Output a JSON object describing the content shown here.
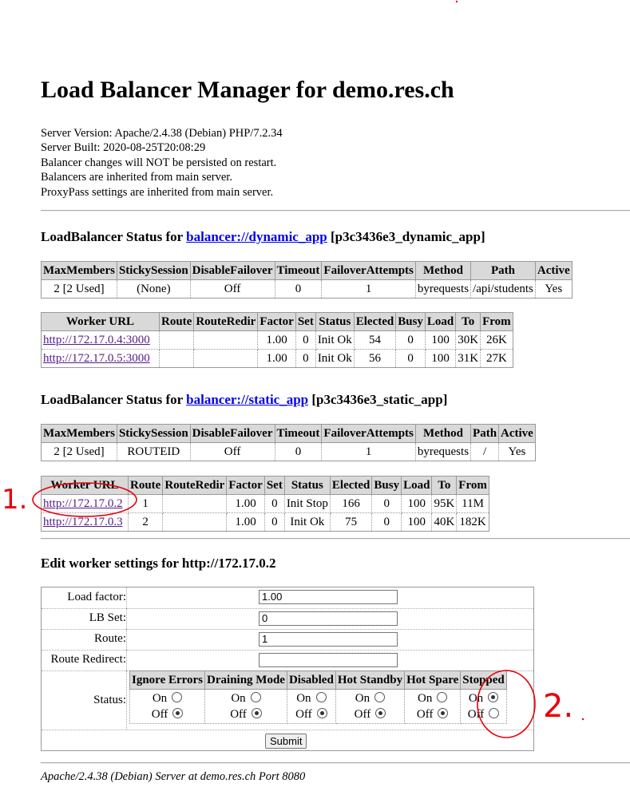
{
  "title": "Load Balancer Manager for demo.res.ch",
  "server_info": [
    "Server Version: Apache/2.4.38 (Debian) PHP/7.2.34",
    "Server Built: 2020-08-25T20:08:29",
    "Balancer changes will NOT be persisted on restart.",
    "Balancers are inherited from main server.",
    "ProxyPass settings are inherited from main server."
  ],
  "balancer1": {
    "heading_prefix": "LoadBalancer Status for ",
    "link": "balancer://dynamic_app",
    "suffix": " [p3c3436e3_dynamic_app]",
    "status_headers": [
      "MaxMembers",
      "StickySession",
      "DisableFailover",
      "Timeout",
      "FailoverAttempts",
      "Method",
      "Path",
      "Active"
    ],
    "status_row": [
      "2 [2 Used]",
      "(None)",
      "Off",
      "0",
      "1",
      "byrequests",
      "/api/students",
      "Yes"
    ],
    "worker_headers": [
      "Worker URL",
      "Route",
      "RouteRedir",
      "Factor",
      "Set",
      "Status",
      "Elected",
      "Busy",
      "Load",
      "To",
      "From"
    ],
    "workers": [
      [
        "http://172.17.0.4:3000",
        "",
        "",
        "1.00",
        "0",
        "Init Ok",
        "54",
        "0",
        "100",
        "30K",
        "26K"
      ],
      [
        "http://172.17.0.5:3000",
        "",
        "",
        "1.00",
        "0",
        "Init Ok",
        "56",
        "0",
        "100",
        "31K",
        "27K"
      ]
    ]
  },
  "balancer2": {
    "heading_prefix": "LoadBalancer Status for ",
    "link": "balancer://static_app",
    "suffix": " [p3c3436e3_static_app]",
    "status_headers": [
      "MaxMembers",
      "StickySession",
      "DisableFailover",
      "Timeout",
      "FailoverAttempts",
      "Method",
      "Path",
      "Active"
    ],
    "status_row": [
      "2 [2 Used]",
      "ROUTEID",
      "Off",
      "0",
      "1",
      "byrequests",
      "/",
      "Yes"
    ],
    "worker_headers": [
      "Worker URL",
      "Route",
      "RouteRedir",
      "Factor",
      "Set",
      "Status",
      "Elected",
      "Busy",
      "Load",
      "To",
      "From"
    ],
    "workers": [
      [
        "http://172.17.0.2",
        "1",
        "",
        "1.00",
        "0",
        "Init Stop",
        "166",
        "0",
        "100",
        "95K",
        "11M"
      ],
      [
        "http://172.17.0.3",
        "2",
        "",
        "1.00",
        "0",
        "Init Ok",
        "75",
        "0",
        "100",
        "40K",
        "182K"
      ]
    ]
  },
  "edit": {
    "heading": "Edit worker settings for http://172.17.0.2",
    "load_factor_label": "Load factor:",
    "load_factor_value": "1.00",
    "lb_set_label": "LB Set:",
    "lb_set_value": "0",
    "route_label": "Route:",
    "route_value": "1",
    "route_redirect_label": "Route Redirect:",
    "route_redirect_value": "",
    "status_label": "Status:",
    "status_headers": [
      "Ignore Errors",
      "Draining Mode",
      "Disabled",
      "Hot Standby",
      "Hot Spare",
      "Stopped"
    ],
    "on_label": "On",
    "off_label": "Off",
    "status_on": [
      false,
      false,
      false,
      false,
      false,
      true
    ],
    "submit_label": "Submit"
  },
  "footer": "Apache/2.4.38 (Debian) Server at demo.res.ch Port 8080",
  "annotations": {
    "mark1": "1.",
    "mark2": "2.",
    "color": "#e8000b"
  }
}
